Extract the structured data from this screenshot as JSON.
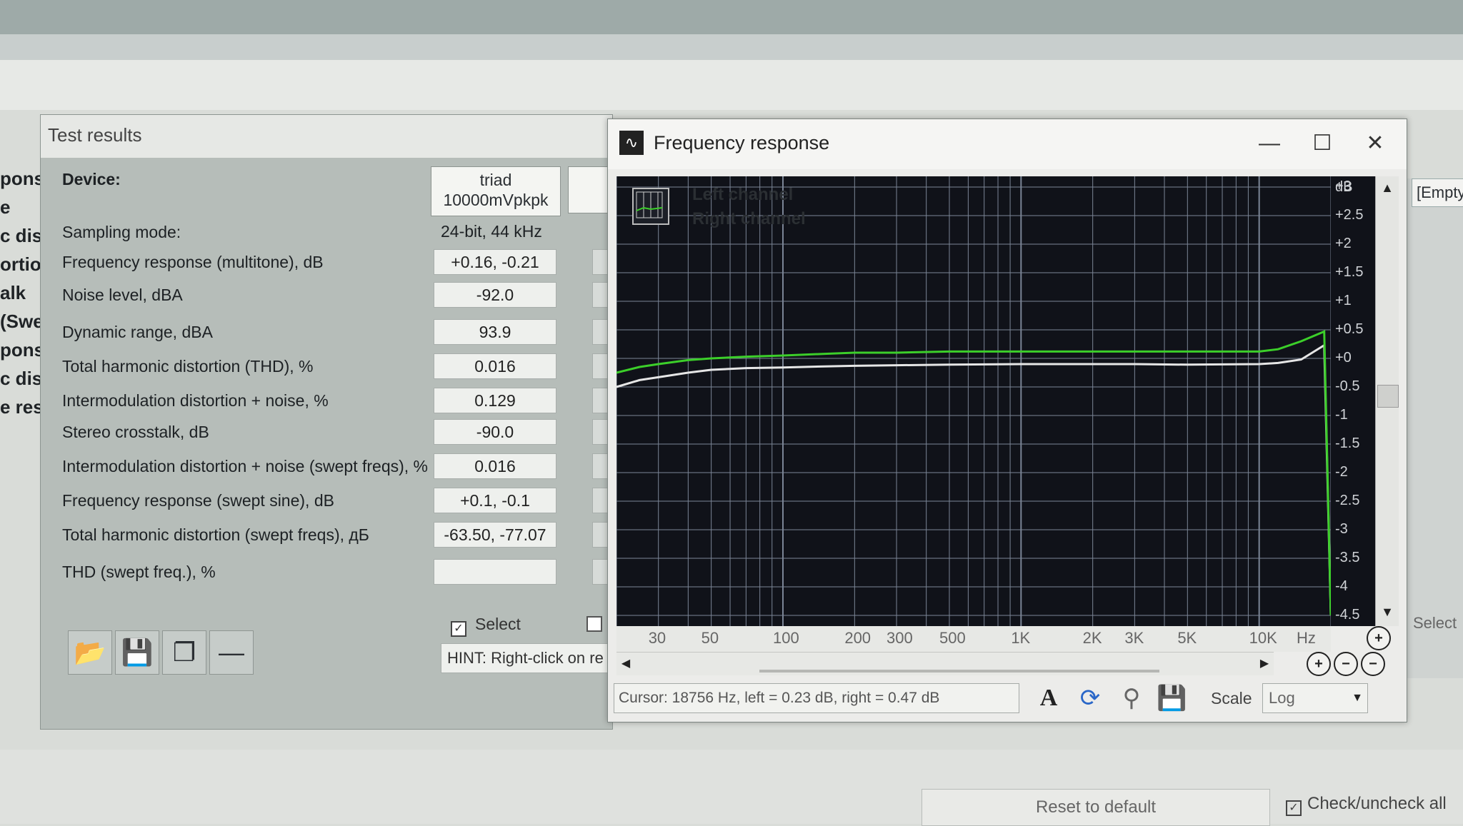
{
  "background": {
    "left_fragments": [
      "pons",
      "e",
      "c dist",
      "ortio",
      "alk",
      "(Swe",
      "pons",
      "c dist",
      "e res"
    ],
    "right_empty": "[Empty",
    "right_select": "Select",
    "reset_button": "Reset to default",
    "check_all": "Check/uncheck all"
  },
  "test_results": {
    "title": "Test results",
    "device_label": "Device:",
    "device_name_line1": "triad",
    "device_name_line2": "10000mVpkpk",
    "sampling_label": "Sampling mode:",
    "sampling_value": "24-bit, 44 kHz",
    "rows": [
      {
        "label": "Frequency response (multitone), dB",
        "value": "+0.16, -0.21"
      },
      {
        "label": "Noise level, dBA",
        "value": "-92.0"
      },
      {
        "label": "Dynamic range, dBA",
        "value": "93.9"
      },
      {
        "label": "Total harmonic distortion (THD), %",
        "value": "0.016"
      },
      {
        "label": "Intermodulation distortion + noise, %",
        "value": "0.129"
      },
      {
        "label": "Stereo crosstalk, dB",
        "value": "-90.0"
      },
      {
        "label": "Intermodulation distortion + noise (swept freqs), %",
        "value": "0.016"
      },
      {
        "label": "Frequency response (swept sine), dB",
        "value": "+0.1, -0.1"
      },
      {
        "label": "Total harmonic distortion (swept freqs), дБ",
        "value": "-63.50, -77.07"
      },
      {
        "label": "THD (swept freq.), %",
        "value": ""
      }
    ],
    "select_label": "Select",
    "hint": "HINT: Right-click on re"
  },
  "freq_window": {
    "title": "Frequency response",
    "minimize": "—",
    "maximize": "☐",
    "close": "✕",
    "legend_left": "Left channel",
    "legend_right": "Right channel",
    "y_unit": "dB",
    "y_labels": [
      "+3",
      "+2.5",
      "+2",
      "+1.5",
      "+1",
      "+0.5",
      "+0",
      "-0.5",
      "-1",
      "-1.5",
      "-2",
      "-2.5",
      "-3",
      "-3.5",
      "-4",
      "-4.5"
    ],
    "x_unit": "Hz",
    "x_labels": [
      "30",
      "50",
      "100",
      "200",
      "300",
      "500",
      "1K",
      "2K",
      "3K",
      "5K",
      "10K"
    ],
    "status": "Cursor: 18756 Hz, left = 0.23 dB, right = 0.47 dB",
    "scale_label": "Scale",
    "scale_value": "Log",
    "colors": {
      "left": "#e6e6e6",
      "right": "#3ccf2a",
      "grid": "#7b8596",
      "bg": "#101219"
    }
  },
  "chart_data": {
    "type": "line",
    "title": "",
    "xlabel": "Hz",
    "ylabel": "dB",
    "xscale": "log",
    "ylim": [
      -4.5,
      3
    ],
    "x": [
      20,
      25,
      30,
      40,
      50,
      70,
      100,
      150,
      200,
      300,
      500,
      1000,
      2000,
      3000,
      5000,
      10000,
      12000,
      15000,
      18756,
      20000
    ],
    "series": [
      {
        "name": "Left channel",
        "values": [
          -0.5,
          -0.38,
          -0.33,
          -0.25,
          -0.2,
          -0.17,
          -0.16,
          -0.14,
          -0.13,
          -0.12,
          -0.11,
          -0.1,
          -0.1,
          -0.1,
          -0.11,
          -0.1,
          -0.08,
          -0.02,
          0.23,
          -4.5
        ]
      },
      {
        "name": "Right channel",
        "values": [
          -0.25,
          -0.15,
          -0.1,
          -0.03,
          0.0,
          0.03,
          0.05,
          0.08,
          0.1,
          0.1,
          0.12,
          0.12,
          0.12,
          0.12,
          0.12,
          0.12,
          0.16,
          0.3,
          0.47,
          -4.5
        ]
      }
    ],
    "grid": true,
    "legend": "top-left"
  }
}
